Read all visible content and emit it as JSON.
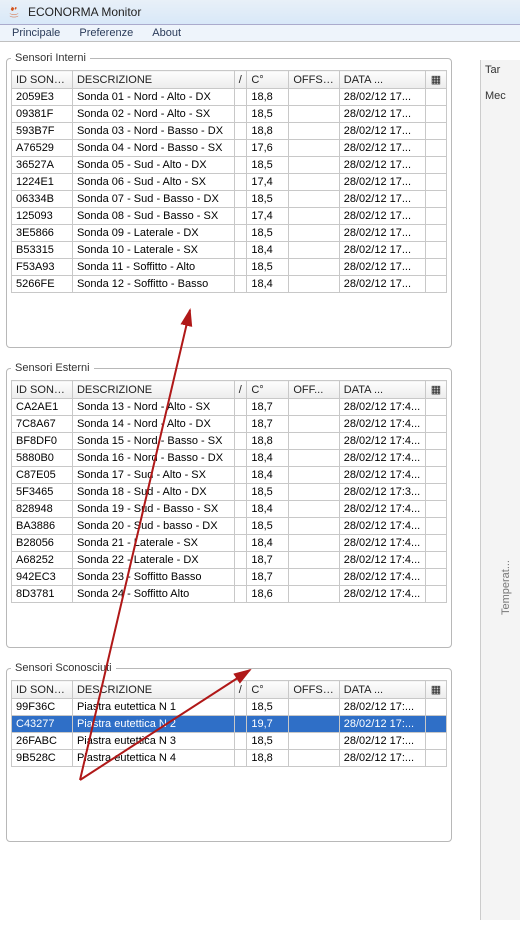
{
  "app": {
    "title": "ECONORMA Monitor"
  },
  "menu": {
    "principale": "Principale",
    "preferenze": "Preferenze",
    "about": "About"
  },
  "rightPane": {
    "line1": "Tar",
    "line2": "Mec",
    "sideLabel": "Temperat..."
  },
  "sections": {
    "interni": {
      "legend": "Sensori Interni"
    },
    "esterni": {
      "legend": "Sensori Esterni"
    },
    "sconosciuti": {
      "legend": "Sensori Sconosciuti"
    }
  },
  "headers": {
    "id": "ID SONDA",
    "desc": "DESCRIZIONE",
    "sort": "/",
    "temp": "C°",
    "offset": "OFFSET",
    "offsetShort": "OFF...",
    "data": "DATA",
    "dataDots": "...",
    "menu": "▦"
  },
  "interni": [
    {
      "id": "2059E3",
      "desc": "Sonda 01 - Nord - Alto - DX",
      "temp": "18,8",
      "off": "",
      "data": "28/02/12 17..."
    },
    {
      "id": "09381F",
      "desc": "Sonda 02 - Nord - Alto - SX",
      "temp": "18,5",
      "off": "",
      "data": "28/02/12 17..."
    },
    {
      "id": "593B7F",
      "desc": "Sonda 03 - Nord - Basso - DX",
      "temp": "18,8",
      "off": "",
      "data": "28/02/12 17..."
    },
    {
      "id": "A76529",
      "desc": "Sonda 04 - Nord - Basso - SX",
      "temp": "17,6",
      "off": "",
      "data": "28/02/12 17..."
    },
    {
      "id": "36527A",
      "desc": "Sonda 05 - Sud - Alto - DX",
      "temp": "18,5",
      "off": "",
      "data": "28/02/12 17..."
    },
    {
      "id": "1224E1",
      "desc": "Sonda 06 - Sud - Alto - SX",
      "temp": "17,4",
      "off": "",
      "data": "28/02/12 17..."
    },
    {
      "id": "06334B",
      "desc": "Sonda 07 - Sud - Basso - DX",
      "temp": "18,5",
      "off": "",
      "data": "28/02/12 17..."
    },
    {
      "id": "125093",
      "desc": "Sonda 08 - Sud - Basso - SX",
      "temp": "17,4",
      "off": "",
      "data": "28/02/12 17..."
    },
    {
      "id": "3E5866",
      "desc": "Sonda 09 - Laterale - DX",
      "temp": "18,5",
      "off": "",
      "data": "28/02/12 17..."
    },
    {
      "id": "B53315",
      "desc": "Sonda 10 - Laterale - SX",
      "temp": "18,4",
      "off": "",
      "data": "28/02/12 17..."
    },
    {
      "id": "F53A93",
      "desc": "Sonda 11 - Soffitto - Alto",
      "temp": "18,5",
      "off": "",
      "data": "28/02/12 17..."
    },
    {
      "id": "5266FE",
      "desc": "Sonda 12 - Soffitto - Basso",
      "temp": "18,4",
      "off": "",
      "data": "28/02/12 17..."
    }
  ],
  "esterni": [
    {
      "id": "CA2AE1",
      "desc": "Sonda 13 - Nord - Alto - SX",
      "temp": "18,7",
      "off": "",
      "data": "28/02/12 17:4..."
    },
    {
      "id": "7C8A67",
      "desc": "Sonda 14 - Nord - Alto - DX",
      "temp": "18,7",
      "off": "",
      "data": "28/02/12 17:4..."
    },
    {
      "id": "BF8DF0",
      "desc": "Sonda 15 - Nord - Basso - SX",
      "temp": "18,8",
      "off": "",
      "data": "28/02/12 17:4..."
    },
    {
      "id": "5880B0",
      "desc": "Sonda 16 - Nord - Basso - DX",
      "temp": "18,4",
      "off": "",
      "data": "28/02/12 17:4..."
    },
    {
      "id": "C87E05",
      "desc": "Sonda 17 - Sud - Alto - SX",
      "temp": "18,4",
      "off": "",
      "data": "28/02/12 17:4..."
    },
    {
      "id": "5F3465",
      "desc": "Sonda 18 - Sud - Alto - DX",
      "temp": "18,5",
      "off": "",
      "data": "28/02/12 17:3..."
    },
    {
      "id": "828948",
      "desc": "Sonda 19 - Sud - Basso - SX",
      "temp": "18,4",
      "off": "",
      "data": "28/02/12 17:4..."
    },
    {
      "id": "BA3886",
      "desc": "Sonda 20 - Sud - basso - DX",
      "temp": "18,5",
      "off": "",
      "data": "28/02/12 17:4..."
    },
    {
      "id": "B28056",
      "desc": "Sonda 21 - Laterale - SX",
      "temp": "18,4",
      "off": "",
      "data": "28/02/12 17:4..."
    },
    {
      "id": "A68252",
      "desc": "Sonda 22 - Laterale - DX",
      "temp": "18,7",
      "off": "",
      "data": "28/02/12 17:4..."
    },
    {
      "id": "942EC3",
      "desc": "Sonda 23 - Soffitto Basso",
      "temp": "18,7",
      "off": "",
      "data": "28/02/12 17:4..."
    },
    {
      "id": "8D3781",
      "desc": "Sonda 24 - Soffitto Alto",
      "temp": "18,6",
      "off": "",
      "data": "28/02/12 17:4..."
    }
  ],
  "sconosciuti": [
    {
      "id": "99F36C",
      "desc": "Piastra eutettica  N 1",
      "temp": "18,5",
      "off": "",
      "data": "28/02/12 17:..."
    },
    {
      "id": "C43277",
      "desc": "Piastra eutettica  N 2",
      "temp": "19,7",
      "off": "",
      "data": "28/02/12 17:...",
      "selected": true
    },
    {
      "id": "26FABC",
      "desc": "Piastra eutettica  N 3",
      "temp": "18,5",
      "off": "",
      "data": "28/02/12 17:..."
    },
    {
      "id": "9B528C",
      "desc": "Piastra eutettica  N 4",
      "temp": "18,8",
      "off": "",
      "data": "28/02/12 17:..."
    }
  ]
}
